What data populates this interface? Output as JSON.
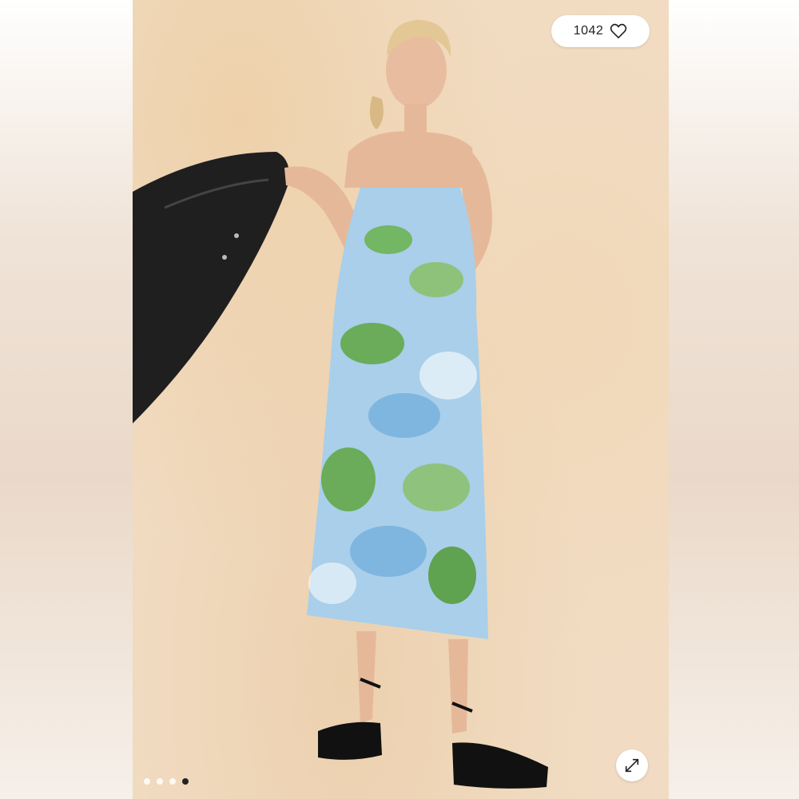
{
  "listing": {
    "like_count": "1042",
    "icons": {
      "like": "heart-outline-icon",
      "expand": "expand-arrows-icon"
    },
    "carousel": {
      "total": 4,
      "active_index": 4
    }
  },
  "colors": {
    "backdrop": "#f1dcc3",
    "dress_blue": "#9cc6e8",
    "dress_green": "#6db35a",
    "jacket": "#222222",
    "pill_bg": "#ffffff"
  }
}
